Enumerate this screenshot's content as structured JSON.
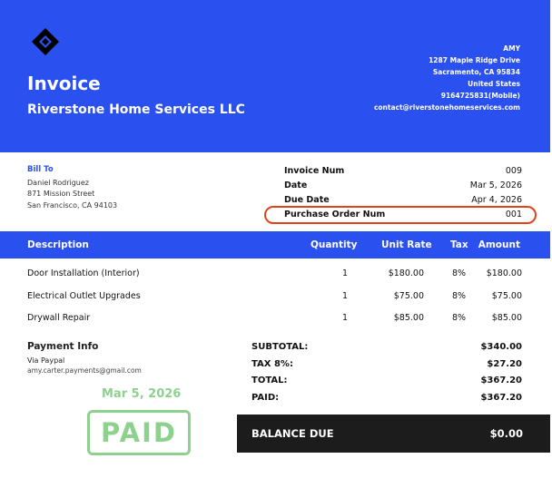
{
  "header": {
    "logo_icon": "diamond-logo-icon",
    "title": "Invoice",
    "company": "Riverstone Home Services LLC",
    "from_lines": [
      "AMY",
      "1287 Maple Ridge Drive",
      "Sacramento, CA 95834",
      "United States",
      "9164725831(Mobile)",
      "contact@riverstonehomeservices.com"
    ]
  },
  "bill_to": {
    "label": "Bill To",
    "lines": [
      "Daniel Rodriguez",
      "871 Mission Street",
      "San Francisco, CA 94103"
    ]
  },
  "meta": [
    {
      "label": "Invoice Num",
      "value": "009"
    },
    {
      "label": "Date",
      "value": "Mar 5, 2026"
    },
    {
      "label": "Due Date",
      "value": "Apr 4, 2026"
    },
    {
      "label": "Purchase Order Num",
      "value": "001"
    }
  ],
  "table": {
    "headers": {
      "description": "Description",
      "quantity": "Quantity",
      "unit_rate": "Unit Rate",
      "tax": "Tax",
      "amount": "Amount"
    },
    "rows": [
      {
        "description": "Door Installation (Interior)",
        "quantity": "1",
        "unit_rate": "$180.00",
        "tax": "8%",
        "amount": "$180.00"
      },
      {
        "description": "Electrical Outlet Upgrades",
        "quantity": "1",
        "unit_rate": "$75.00",
        "tax": "8%",
        "amount": "$75.00"
      },
      {
        "description": "Drywall Repair",
        "quantity": "1",
        "unit_rate": "$85.00",
        "tax": "8%",
        "amount": "$85.00"
      }
    ]
  },
  "payment": {
    "heading": "Payment Info",
    "method": "Via Paypal",
    "email": "amy.carter.payments@gmail.com",
    "paid_date": "Mar 5, 2026",
    "stamp": "PAID"
  },
  "totals": [
    {
      "label": "SUBTOTAL:",
      "value": "$340.00"
    },
    {
      "label": "TAX 8%:",
      "value": "$27.20"
    },
    {
      "label": "TOTAL:",
      "value": "$367.20"
    },
    {
      "label": "PAID:",
      "value": "$367.20"
    }
  ],
  "balance": {
    "label": "BALANCE DUE",
    "value": "$0.00"
  },
  "colors": {
    "brand": "#2b50f0",
    "highlight": "#e2421a",
    "stamp": "#8ed18e",
    "balance_bg": "#1c1c1c"
  }
}
